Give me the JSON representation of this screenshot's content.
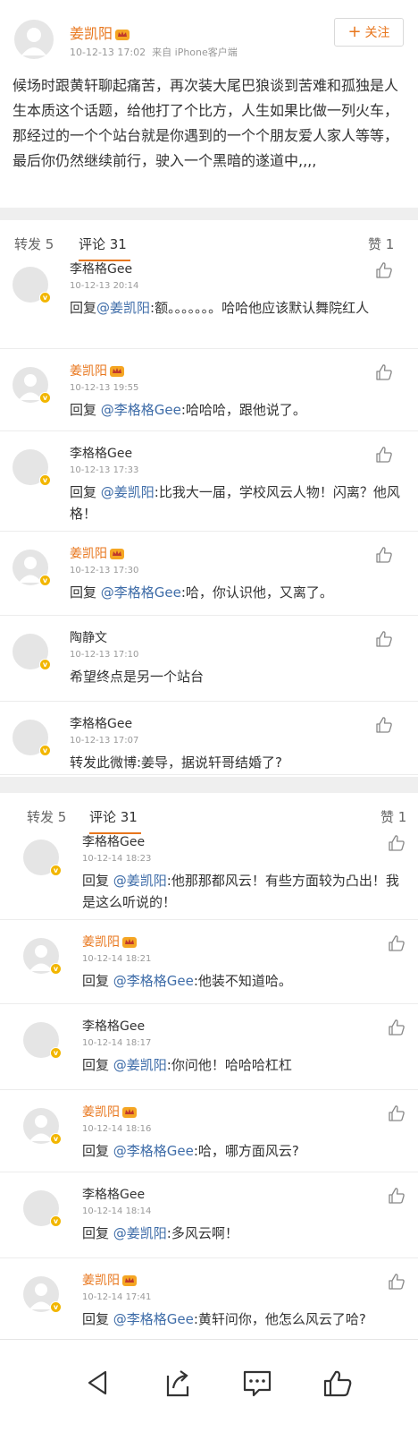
{
  "post": {
    "author": "姜凯阳",
    "time": "10-12-13 17:02",
    "source": "来自 iPhone客户端",
    "follow_label": "关注",
    "body": "候场时跟黄轩聊起痛苦，再次装大尾巴狼谈到苦难和孤独是人生本质这个话题，给他打了个比方，人生如果比做一列火车，那经过的一个个站台就是你遇到的一个个朋友爱人家人等等，最后你仍然继续前行，驶入一个黑暗的遂道中,,,,"
  },
  "tabs1": {
    "repost": "转发 5",
    "comments": "评论 31",
    "likes": "赞 1"
  },
  "comments1": [
    {
      "name": "李格格Gee",
      "time": "10-12-13 20:14",
      "prefix": "回复",
      "mention": "@姜凯阳",
      "text": ":额。。。。。。。哈哈他应该默认舞院红人"
    },
    {
      "name": "姜凯阳",
      "time": "10-12-13 19:55",
      "prefix": "回复 ",
      "mention": "@李格格Gee",
      "text": ":哈哈哈，跟他说了。"
    },
    {
      "name": "李格格Gee",
      "time": "10-12-13 17:33",
      "prefix": "回复 ",
      "mention": "@姜凯阳",
      "text": ":比我大一届，学校风云人物！闪离？他风格！"
    },
    {
      "name": "姜凯阳",
      "time": "10-12-13 17:30",
      "prefix": "回复 ",
      "mention": "@李格格Gee",
      "text": ":哈，你认识他，又离了。"
    },
    {
      "name": "陶静文",
      "time": "10-12-13 17:10",
      "prefix": "",
      "mention": "",
      "text": "希望终点是另一个站台"
    },
    {
      "name": "李格格Gee",
      "time": "10-12-13 17:07",
      "prefix": "",
      "mention": "",
      "text": "转发此微博:姜导，据说轩哥结婚了?"
    }
  ],
  "tabs2": {
    "repost": "转发 5",
    "comments": "评论 31",
    "likes": "赞 1"
  },
  "comments2": [
    {
      "name": "李格格Gee",
      "time": "10-12-14 18:23",
      "prefix": "回复 ",
      "mention": "@姜凯阳",
      "text": ":他那那都风云！有些方面较为凸出！我是这么听说的！"
    },
    {
      "name": "姜凯阳",
      "time": "10-12-14 18:21",
      "prefix": "回复 ",
      "mention": "@李格格Gee",
      "text": ":他装不知道哈。"
    },
    {
      "name": "李格格Gee",
      "time": "10-12-14 18:17",
      "prefix": "回复 ",
      "mention": "@姜凯阳",
      "text": ":你问他！哈哈哈杠杠"
    },
    {
      "name": "姜凯阳",
      "time": "10-12-14 18:16",
      "prefix": "回复 ",
      "mention": "@李格格Gee",
      "text": ":哈，哪方面风云?"
    },
    {
      "name": "李格格Gee",
      "time": "10-12-14 18:14",
      "prefix": "回复 ",
      "mention": "@姜凯阳",
      "text": ":多风云啊！"
    },
    {
      "name": "姜凯阳",
      "time": "10-12-14 17:41",
      "prefix": "回复 ",
      "mention": "@李格格Gee",
      "text": ":黄轩问你，他怎么风云了哈?"
    }
  ],
  "colors": {
    "accent": "#e8761c",
    "mention": "#3e6ca8",
    "verified": "#f2b600"
  }
}
